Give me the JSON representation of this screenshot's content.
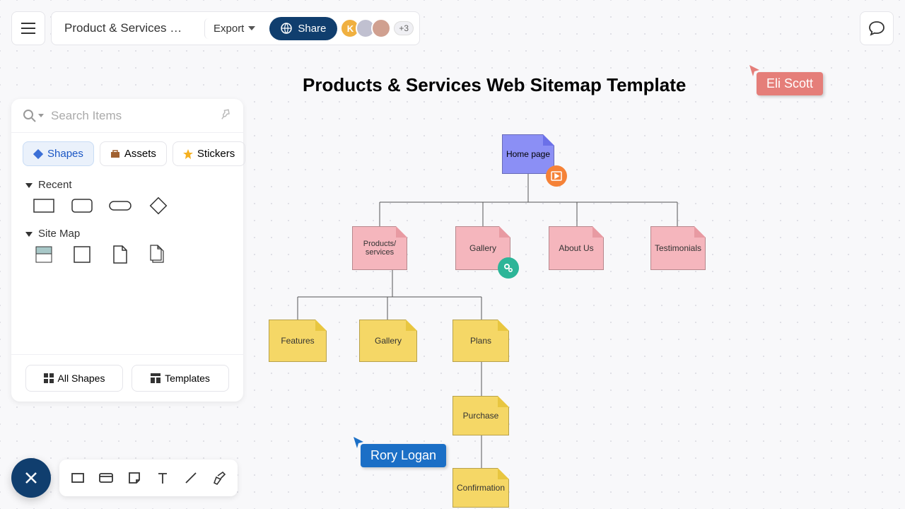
{
  "doc_title": "Product & Services Web...",
  "export_label": "Export",
  "share_label": "Share",
  "avatar_initial": "K",
  "more_count": "+3",
  "search": {
    "placeholder": "Search Items"
  },
  "tabs": {
    "shapes": "Shapes",
    "assets": "Assets",
    "stickers": "Stickers"
  },
  "sections": {
    "recent": "Recent",
    "sitemap": "Site Map"
  },
  "footer": {
    "allshapes": "All Shapes",
    "templates": "Templates"
  },
  "canvas_title": "Products & Services Web Sitemap Template",
  "nodes": {
    "home": "Home page",
    "products": "Products/\nservices",
    "gallery1": "Gallery",
    "about": "About Us",
    "testimonials": "Testimonials",
    "features": "Features",
    "gallery2": "Gallery",
    "plans": "Plans",
    "purchase": "Purchase",
    "confirmation": "Confirmation"
  },
  "cursors": {
    "eli": "Eli Scott",
    "rory": "Rory Logan"
  },
  "colors": {
    "accent": "#103e6e",
    "nodePurple": "#8b8ff5",
    "nodePink": "#f5b6bd",
    "nodeYellow": "#f5d766"
  }
}
